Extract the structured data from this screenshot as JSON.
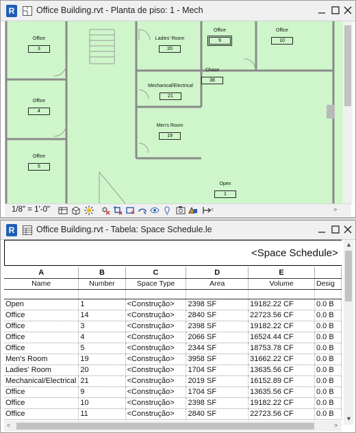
{
  "plan_window": {
    "title": "Office Building.rvt - Planta de piso: 1 - Mech",
    "app_icon_letter": "R",
    "scale_label": "1/8\" = 1'-0\"",
    "rooms": [
      {
        "name": "Office",
        "number": "3"
      },
      {
        "name": "Office",
        "number": "4"
      },
      {
        "name": "Office",
        "number": "5"
      },
      {
        "name": "Ladies' Room",
        "number": "20"
      },
      {
        "name": "Mechanical/Electrical",
        "number": "21"
      },
      {
        "name": "Men's Room",
        "number": "19"
      },
      {
        "name": "Chase",
        "number": "38"
      },
      {
        "name": "Office",
        "number": "9"
      },
      {
        "name": "Office",
        "number": "10"
      },
      {
        "name": "Open",
        "number": "1"
      }
    ],
    "colors": {
      "plan_fill": "#cff6cb",
      "walls": "#8a8a8a"
    }
  },
  "schedule_window": {
    "title": "Office Building.rvt - Tabela: Space Schedule.le",
    "app_icon_letter": "R",
    "schedule_title": "<Space Schedule>",
    "columns": [
      {
        "letter": "A",
        "header": "Name"
      },
      {
        "letter": "B",
        "header": "Number"
      },
      {
        "letter": "C",
        "header": "Space Type"
      },
      {
        "letter": "D",
        "header": "Area"
      },
      {
        "letter": "E",
        "header": "Volume"
      },
      {
        "letter": "",
        "header": "Desig"
      }
    ],
    "rows": [
      {
        "name": "Open",
        "number": "1",
        "type": "<Construção>",
        "area": "2398 SF",
        "volume": "19182.22 CF",
        "design": "0.0 B"
      },
      {
        "name": "Office",
        "number": "14",
        "type": "<Construção>",
        "area": "2840 SF",
        "volume": "22723.56 CF",
        "design": "0.0 B"
      },
      {
        "name": "Office",
        "number": "3",
        "type": "<Construção>",
        "area": "2398 SF",
        "volume": "19182.22 CF",
        "design": "0.0 B"
      },
      {
        "name": "Office",
        "number": "4",
        "type": "<Construção>",
        "area": "2066 SF",
        "volume": "16524.44 CF",
        "design": "0.0 B"
      },
      {
        "name": "Office",
        "number": "5",
        "type": "<Construção>",
        "area": "2344 SF",
        "volume": "18753.78 CF",
        "design": "0.0 B"
      },
      {
        "name": "Men's Room",
        "number": "19",
        "type": "<Construção>",
        "area": "3958 SF",
        "volume": "31662.22 CF",
        "design": "0.0 B"
      },
      {
        "name": "Ladies' Room",
        "number": "20",
        "type": "<Construção>",
        "area": "1704 SF",
        "volume": "13635.56 CF",
        "design": "0.0 B"
      },
      {
        "name": "Mechanical/Electrical",
        "number": "21",
        "type": "<Construção>",
        "area": "2019 SF",
        "volume": "16152.89 CF",
        "design": "0.0 B"
      },
      {
        "name": "Office",
        "number": "9",
        "type": "<Construção>",
        "area": "1704 SF",
        "volume": "13635.56 CF",
        "design": "0.0 B"
      },
      {
        "name": "Office",
        "number": "10",
        "type": "<Construção>",
        "area": "2398 SF",
        "volume": "19182.22 CF",
        "design": "0.0 B"
      },
      {
        "name": "Office",
        "number": "11",
        "type": "<Construção>",
        "area": "2840 SF",
        "volume": "22723.56 CF",
        "design": "0.0 B"
      }
    ]
  }
}
